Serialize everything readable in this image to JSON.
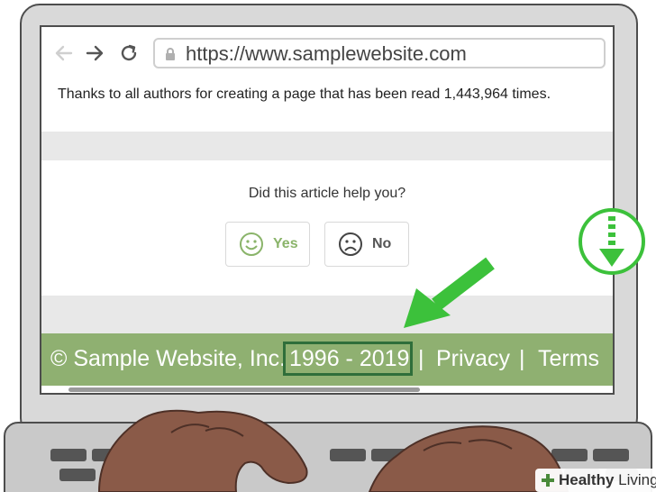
{
  "browser": {
    "url": "https://www.samplewebsite.com",
    "back_icon": "arrow-left-icon",
    "forward_icon": "arrow-right-icon",
    "reload_icon": "reload-icon",
    "lock_icon": "lock-icon"
  },
  "article": {
    "read_count_text": "Thanks to all authors for creating a page that has been read 1,443,964 times."
  },
  "feedback": {
    "question": "Did this article help you?",
    "yes_label": "Yes",
    "no_label": "No",
    "yes_color": "#8ab46a",
    "no_color": "#555555"
  },
  "footer": {
    "company": "© Sample Website, Inc.",
    "years": "1996 - 2019",
    "separator": "|",
    "privacy": "Privacy",
    "terms": "Terms",
    "background_color": "#8fb071",
    "highlight_color": "#2f6e3a"
  },
  "annotations": {
    "accent_color": "#3cc13b",
    "scroll_badge_icon": "scroll-down-icon",
    "pointer_icon": "pointer-arrow-icon"
  },
  "watermark": {
    "brand_bold": "Healthy",
    "brand_rest": " Living"
  }
}
